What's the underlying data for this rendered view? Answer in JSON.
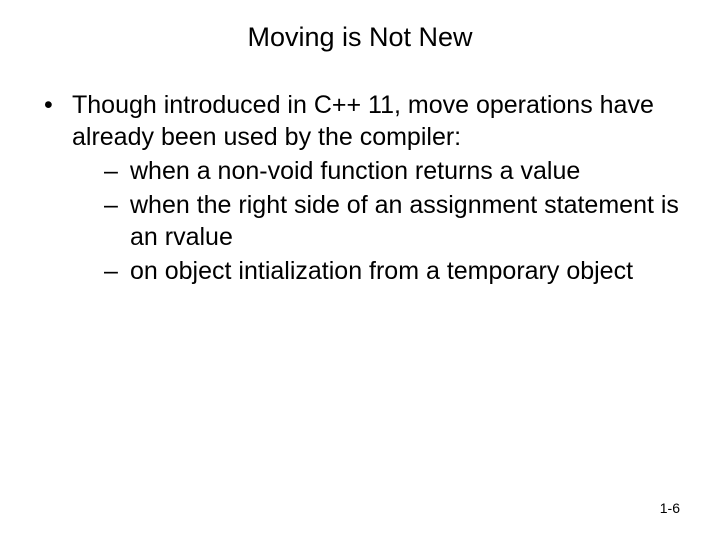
{
  "slide": {
    "title": "Moving is Not New",
    "bullet": {
      "mark": "•",
      "text": "Though introduced in C++ 11, move operations have already been used by the compiler:"
    },
    "subitems": [
      {
        "dash": "–",
        "text": "when a non-void function returns a value"
      },
      {
        "dash": "–",
        "text": "when the right side of an assignment statement is an rvalue"
      },
      {
        "dash": "–",
        "text": "on object intialization from a temporary object"
      }
    ],
    "page": "1-6"
  }
}
